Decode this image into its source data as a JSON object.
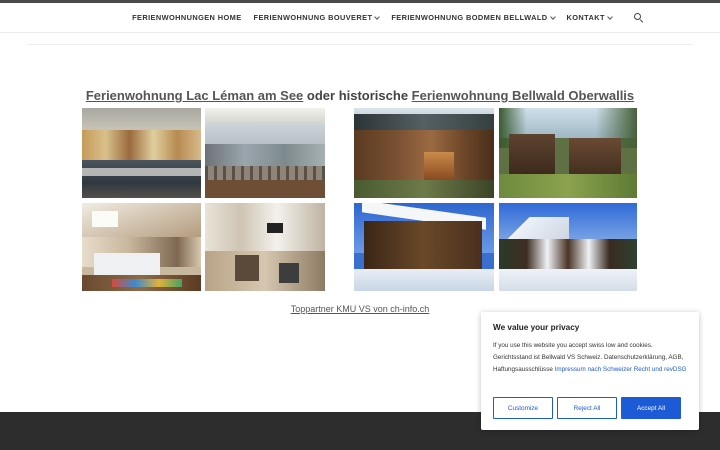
{
  "nav": {
    "items": [
      {
        "label": "FERIENWOHNUNGEN HOME",
        "dropdown": false
      },
      {
        "label": "FERIENWOHNUNG BOUVERET",
        "dropdown": true
      },
      {
        "label": "FERIENWOHNUNG BODMEN BELLWALD",
        "dropdown": true
      },
      {
        "label": "KONTAKT",
        "dropdown": true
      }
    ],
    "search_icon": "search-icon"
  },
  "headline": {
    "link1": "Ferienwohnung Lac Léman am See",
    "middle": " oder historische ",
    "link2": "Ferienwohnung Bellwald Oberwallis"
  },
  "gallery": {
    "left_title": "Ferienwohnung Lac Léman am See",
    "right_title": "Ferienwohnung Bellwald Oberwallis",
    "left_images": [
      "harbor-houses-photo",
      "marina-balcony-photo",
      "attic-bedroom-photo",
      "living-room-photo"
    ],
    "right_images": [
      "wooden-chalet-summer-photo",
      "old-barns-photo",
      "chalet-snow-photo",
      "snowy-village-photo"
    ]
  },
  "partner_link": "Toppartner KMU VS von ch-info.ch",
  "cookie": {
    "title": "We value your privacy",
    "text": "If you use this website you accept swiss low and cookies. Gerichtsstand ist Bellwald VS Schweiz. Datenschutzerklärung, AGB, Haftungsausschlüsse ",
    "link": "Impressum nach Schweizer Recht und revDSG",
    "customize": "Customize",
    "reject": "Reject All",
    "accept": "Accept All",
    "accent_color": "#1d5bd6"
  }
}
